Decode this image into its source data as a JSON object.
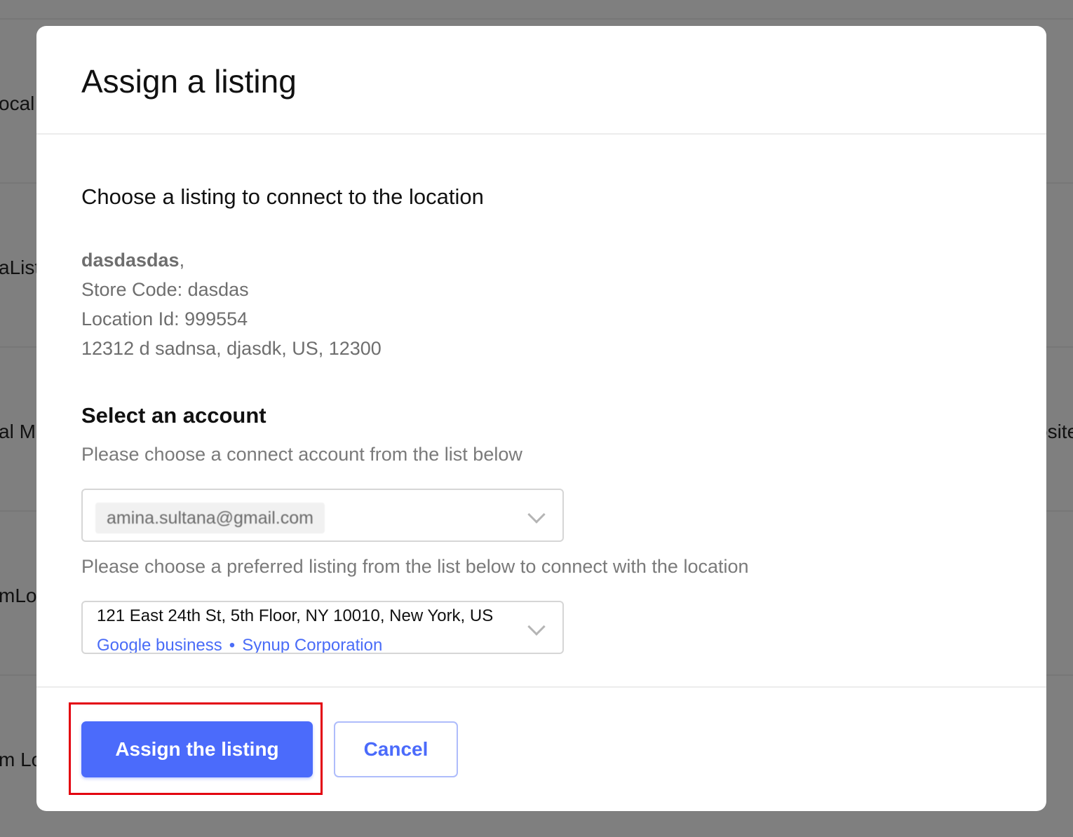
{
  "background": {
    "row_fragments": [
      "ocal",
      "aList",
      "al Mi",
      "mLoc",
      "m Lo"
    ],
    "right_fragment": "osite"
  },
  "modal": {
    "title": "Assign a listing",
    "subtitle": "Choose a listing to connect to the location",
    "location": {
      "name": "dasdasdas",
      "name_suffix": ",",
      "store_code": "Store Code: dasdas",
      "location_id": "Location Id: 999554",
      "address": "12312 d sadnsa, djasdk, US, 12300"
    },
    "account_section": {
      "title": "Select an account",
      "hint": "Please choose a connect account from the list below",
      "selected_account": "amina.sultana@gmail.com"
    },
    "listing_section": {
      "hint": "Please choose a preferred listing from the list below to connect with the location",
      "selected_listing": {
        "address": "121 East 24th St, 5th Floor, NY 10010, New York, US",
        "source": "Google business",
        "separator": "•",
        "organization": "Synup Corporation"
      }
    },
    "footer": {
      "assign_label": "Assign the listing",
      "cancel_label": "Cancel"
    }
  },
  "colors": {
    "accent": "#4b6bfb",
    "highlight": "#e3000f",
    "overlay": "#7f7f7f"
  }
}
